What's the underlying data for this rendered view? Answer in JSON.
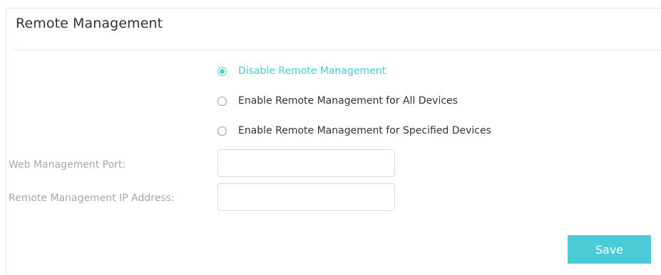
{
  "panel": {
    "title": "Remote Management"
  },
  "mode_options": [
    {
      "label": "Disable Remote Management",
      "checked": true
    },
    {
      "label": "Enable Remote Management for All Devices",
      "checked": false
    },
    {
      "label": "Enable Remote Management for Specified Devices",
      "checked": false
    }
  ],
  "fields": {
    "web_port_label": "Web Management Port:",
    "web_port_value": "",
    "remote_ip_label": "Remote Management IP Address:",
    "remote_ip_value": ""
  },
  "actions": {
    "save_label": "Save"
  },
  "colors": {
    "accent": "#4acbd6",
    "muted_label": "#a6a6a6",
    "border": "#d9d9d9"
  }
}
